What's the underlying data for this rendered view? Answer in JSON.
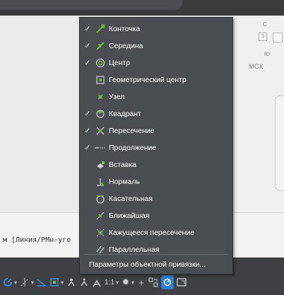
{
  "osnap_menu": {
    "items": [
      {
        "label": "Конточка",
        "checked": true,
        "icon": "endpoint-icon"
      },
      {
        "label": "Середина",
        "checked": true,
        "icon": "midpoint-icon"
      },
      {
        "label": "Центр",
        "checked": true,
        "icon": "center-icon"
      },
      {
        "label": "Геометрический центр",
        "checked": false,
        "icon": "geometric-center-icon"
      },
      {
        "label": "Узел",
        "checked": false,
        "icon": "node-icon"
      },
      {
        "label": "Квадрант",
        "checked": true,
        "icon": "quadrant-icon"
      },
      {
        "label": "Пересечение",
        "checked": true,
        "icon": "intersection-icon"
      },
      {
        "label": "Продолжение",
        "checked": true,
        "icon": "extension-icon"
      },
      {
        "label": "Вставка",
        "checked": false,
        "icon": "insertion-icon"
      },
      {
        "label": "Нормаль",
        "checked": false,
        "icon": "perpendicular-icon"
      },
      {
        "label": "Касательная",
        "checked": false,
        "icon": "tangent-icon"
      },
      {
        "label": "Ближайшая",
        "checked": false,
        "icon": "nearest-icon"
      },
      {
        "label": "Кажущееся пересечение",
        "checked": false,
        "icon": "apparent-intersection-icon"
      },
      {
        "label": "Параллельная",
        "checked": false,
        "icon": "parallel-icon"
      }
    ],
    "settings_label": "Параметры объектной привязки...",
    "check_glyph": "✓"
  },
  "command_line": {
    "text": "м [Линия/РМн-уго"
  },
  "viewcube": {
    "top_letter": "С",
    "left_letter": "З",
    "bottom_letter": "Ю",
    "wcs_label": "МСК"
  },
  "status_bar": {
    "scale_label": "1:1",
    "icons": [
      "polar-icon",
      "osnap-track-icon",
      "isodraft-icon",
      "snap-icon",
      "annotation-scale-icon",
      "workspace-gear-icon",
      "plus-icon",
      "units-icon",
      "hardware-accel-icon",
      "fullscreen-icon"
    ]
  },
  "colors": {
    "menu_bg": "#4a4d52",
    "statusbar_bg": "#3f4043",
    "accent_blue": "#2f7ed0",
    "snap_green": "#7ec23b"
  }
}
